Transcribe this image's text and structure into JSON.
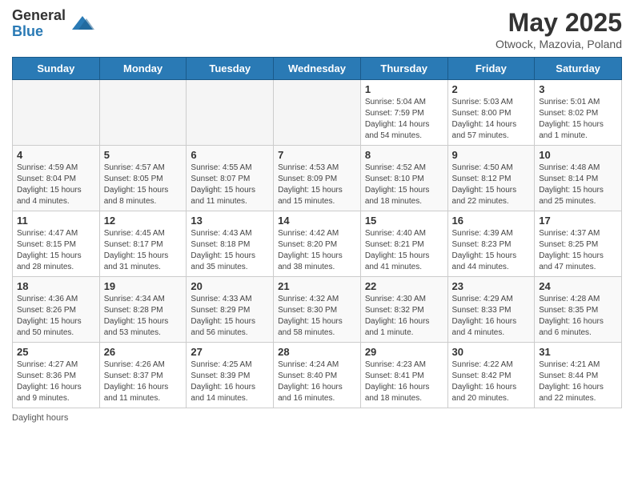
{
  "logo": {
    "general": "General",
    "blue": "Blue"
  },
  "title": "May 2025",
  "subtitle": "Otwock, Mazovia, Poland",
  "days_of_week": [
    "Sunday",
    "Monday",
    "Tuesday",
    "Wednesday",
    "Thursday",
    "Friday",
    "Saturday"
  ],
  "weeks": [
    [
      {
        "day": "",
        "info": ""
      },
      {
        "day": "",
        "info": ""
      },
      {
        "day": "",
        "info": ""
      },
      {
        "day": "",
        "info": ""
      },
      {
        "day": "1",
        "info": "Sunrise: 5:04 AM\nSunset: 7:59 PM\nDaylight: 14 hours\nand 54 minutes."
      },
      {
        "day": "2",
        "info": "Sunrise: 5:03 AM\nSunset: 8:00 PM\nDaylight: 14 hours\nand 57 minutes."
      },
      {
        "day": "3",
        "info": "Sunrise: 5:01 AM\nSunset: 8:02 PM\nDaylight: 15 hours\nand 1 minute."
      }
    ],
    [
      {
        "day": "4",
        "info": "Sunrise: 4:59 AM\nSunset: 8:04 PM\nDaylight: 15 hours\nand 4 minutes."
      },
      {
        "day": "5",
        "info": "Sunrise: 4:57 AM\nSunset: 8:05 PM\nDaylight: 15 hours\nand 8 minutes."
      },
      {
        "day": "6",
        "info": "Sunrise: 4:55 AM\nSunset: 8:07 PM\nDaylight: 15 hours\nand 11 minutes."
      },
      {
        "day": "7",
        "info": "Sunrise: 4:53 AM\nSunset: 8:09 PM\nDaylight: 15 hours\nand 15 minutes."
      },
      {
        "day": "8",
        "info": "Sunrise: 4:52 AM\nSunset: 8:10 PM\nDaylight: 15 hours\nand 18 minutes."
      },
      {
        "day": "9",
        "info": "Sunrise: 4:50 AM\nSunset: 8:12 PM\nDaylight: 15 hours\nand 22 minutes."
      },
      {
        "day": "10",
        "info": "Sunrise: 4:48 AM\nSunset: 8:14 PM\nDaylight: 15 hours\nand 25 minutes."
      }
    ],
    [
      {
        "day": "11",
        "info": "Sunrise: 4:47 AM\nSunset: 8:15 PM\nDaylight: 15 hours\nand 28 minutes."
      },
      {
        "day": "12",
        "info": "Sunrise: 4:45 AM\nSunset: 8:17 PM\nDaylight: 15 hours\nand 31 minutes."
      },
      {
        "day": "13",
        "info": "Sunrise: 4:43 AM\nSunset: 8:18 PM\nDaylight: 15 hours\nand 35 minutes."
      },
      {
        "day": "14",
        "info": "Sunrise: 4:42 AM\nSunset: 8:20 PM\nDaylight: 15 hours\nand 38 minutes."
      },
      {
        "day": "15",
        "info": "Sunrise: 4:40 AM\nSunset: 8:21 PM\nDaylight: 15 hours\nand 41 minutes."
      },
      {
        "day": "16",
        "info": "Sunrise: 4:39 AM\nSunset: 8:23 PM\nDaylight: 15 hours\nand 44 minutes."
      },
      {
        "day": "17",
        "info": "Sunrise: 4:37 AM\nSunset: 8:25 PM\nDaylight: 15 hours\nand 47 minutes."
      }
    ],
    [
      {
        "day": "18",
        "info": "Sunrise: 4:36 AM\nSunset: 8:26 PM\nDaylight: 15 hours\nand 50 minutes."
      },
      {
        "day": "19",
        "info": "Sunrise: 4:34 AM\nSunset: 8:28 PM\nDaylight: 15 hours\nand 53 minutes."
      },
      {
        "day": "20",
        "info": "Sunrise: 4:33 AM\nSunset: 8:29 PM\nDaylight: 15 hours\nand 56 minutes."
      },
      {
        "day": "21",
        "info": "Sunrise: 4:32 AM\nSunset: 8:30 PM\nDaylight: 15 hours\nand 58 minutes."
      },
      {
        "day": "22",
        "info": "Sunrise: 4:30 AM\nSunset: 8:32 PM\nDaylight: 16 hours\nand 1 minute."
      },
      {
        "day": "23",
        "info": "Sunrise: 4:29 AM\nSunset: 8:33 PM\nDaylight: 16 hours\nand 4 minutes."
      },
      {
        "day": "24",
        "info": "Sunrise: 4:28 AM\nSunset: 8:35 PM\nDaylight: 16 hours\nand 6 minutes."
      }
    ],
    [
      {
        "day": "25",
        "info": "Sunrise: 4:27 AM\nSunset: 8:36 PM\nDaylight: 16 hours\nand 9 minutes."
      },
      {
        "day": "26",
        "info": "Sunrise: 4:26 AM\nSunset: 8:37 PM\nDaylight: 16 hours\nand 11 minutes."
      },
      {
        "day": "27",
        "info": "Sunrise: 4:25 AM\nSunset: 8:39 PM\nDaylight: 16 hours\nand 14 minutes."
      },
      {
        "day": "28",
        "info": "Sunrise: 4:24 AM\nSunset: 8:40 PM\nDaylight: 16 hours\nand 16 minutes."
      },
      {
        "day": "29",
        "info": "Sunrise: 4:23 AM\nSunset: 8:41 PM\nDaylight: 16 hours\nand 18 minutes."
      },
      {
        "day": "30",
        "info": "Sunrise: 4:22 AM\nSunset: 8:42 PM\nDaylight: 16 hours\nand 20 minutes."
      },
      {
        "day": "31",
        "info": "Sunrise: 4:21 AM\nSunset: 8:44 PM\nDaylight: 16 hours\nand 22 minutes."
      }
    ]
  ],
  "footer": {
    "label": "Daylight hours"
  }
}
